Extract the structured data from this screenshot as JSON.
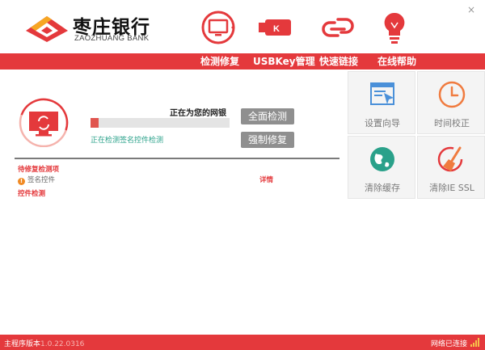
{
  "header": {
    "brand_name": "枣庄银行",
    "brand_en": "ZAOZHUANG BANK",
    "close_label": "×"
  },
  "nav": {
    "items": [
      {
        "label": "检测修复",
        "icon": "monitor-refresh-icon"
      },
      {
        "label": "USBKey管理",
        "icon": "usbkey-icon"
      },
      {
        "label": "快速链接",
        "icon": "link-chain-icon"
      },
      {
        "label": "在线帮助",
        "icon": "lightbulb-icon"
      }
    ]
  },
  "scan": {
    "title": "正在为您的网银",
    "progress": 0.06,
    "status": "正在检测签名控件检测",
    "full_scan_label": "全面检测",
    "force_repair_label": "强制修复"
  },
  "results": {
    "pending_title": "待修复检测项",
    "item_label": "签名控件",
    "detail_label": "详情",
    "control_title": "控件检测"
  },
  "tiles": [
    {
      "label": "设置向导",
      "icon": "setup-wizard-icon"
    },
    {
      "label": "时间校正",
      "icon": "clock-icon"
    },
    {
      "label": "清除缓存",
      "icon": "globe-icon"
    },
    {
      "label": "清除IE SSL",
      "icon": "broom-icon"
    }
  ],
  "footer": {
    "version_label": "主程序版本",
    "version_num": "1.0.22.0316",
    "network_status": "网络已连接"
  },
  "colors": {
    "brand_red": "#e4393c",
    "accent_orange": "#f08a24",
    "teal": "#2aa18a"
  }
}
